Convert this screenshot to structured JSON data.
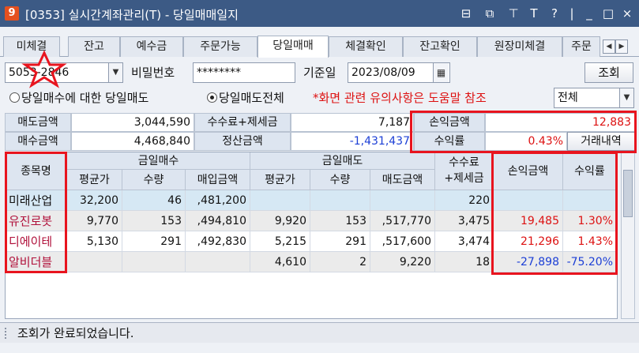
{
  "window": {
    "badge": "9",
    "title": "[0353] 실시간계좌관리(T) - 당일매매일지",
    "controls": [
      "⊟",
      "⧉",
      "⊤",
      "T",
      "?",
      "|",
      "_",
      "□",
      "×"
    ]
  },
  "tabs": [
    {
      "label": "미체결",
      "active": false
    },
    {
      "label": "잔고",
      "active": false
    },
    {
      "label": "예수금",
      "active": false
    },
    {
      "label": "주문가능",
      "active": false
    },
    {
      "label": "당일매매",
      "active": true
    },
    {
      "label": "체결확인",
      "active": false
    },
    {
      "label": "잔고확인",
      "active": false
    },
    {
      "label": "원장미체결",
      "active": false
    },
    {
      "label": "주문",
      "active": false
    }
  ],
  "tab_nav": {
    "prev": "◀",
    "next": "▶"
  },
  "account_row": {
    "account_value": "5053-2846",
    "password_label": "비밀번호",
    "password_value": "********",
    "base_date_label": "기준일",
    "base_date_value": "2023/08/09",
    "query_button": "조회"
  },
  "options_row": {
    "radio1_label": "당일매수에 대한 당일매도",
    "radio2_label": "당일매도전체",
    "selected": "radio2",
    "notice": "*화면 관련 유의사항은 도움말 참조",
    "filter_value": "전체"
  },
  "summary": {
    "sell_amount_label": "매도금액",
    "sell_amount": "3,044,590",
    "fee_tax_label": "수수료+제세금",
    "fee_tax": "7,187",
    "pnl_label": "손익금액",
    "pnl": "12,883",
    "buy_amount_label": "매수금액",
    "buy_amount": "4,468,840",
    "settle_label": "정산금액",
    "settle": "-1,431,437",
    "return_label": "수익률",
    "return": "0.43%",
    "history_button": "거래내역"
  },
  "grid": {
    "headers": {
      "name": "종목명",
      "buy_group": "금일매수",
      "sell_group": "금일매도",
      "fee": "수수료\n+제세금",
      "pnl": "손익금액",
      "ret": "수익률",
      "buy_avg": "평균가",
      "buy_qty": "수량",
      "buy_amt": "매입금액",
      "sell_avg": "평균가",
      "sell_qty": "수량",
      "sell_amt": "매도금액"
    },
    "rows": [
      {
        "name": "미래산업",
        "buy_avg": "32,200",
        "buy_qty": "46",
        "buy_amt": ",481,200",
        "sell_avg": "",
        "sell_qty": "",
        "sell_amt": "",
        "fee": "220",
        "pnl": "",
        "ret": ""
      },
      {
        "name": "유진로봇",
        "buy_avg": "9,770",
        "buy_qty": "153",
        "buy_amt": ",494,810",
        "sell_avg": "9,920",
        "sell_qty": "153",
        "sell_amt": ",517,770",
        "fee": "3,475",
        "pnl": "19,485",
        "ret": "1.30%"
      },
      {
        "name": "디에이테",
        "buy_avg": "5,130",
        "buy_qty": "291",
        "buy_amt": ",492,830",
        "sell_avg": "5,215",
        "sell_qty": "291",
        "sell_amt": ",517,600",
        "fee": "3,474",
        "pnl": "21,296",
        "ret": "1.43%"
      },
      {
        "name": "알비더블",
        "buy_avg": "",
        "buy_qty": "",
        "buy_amt": "",
        "sell_avg": "4,610",
        "sell_qty": "2",
        "sell_amt": "9,220",
        "fee": "18",
        "pnl": "-27,898",
        "ret": "-75.20%"
      }
    ]
  },
  "status": {
    "text": "조회가 완료되었습니다."
  },
  "colors": {
    "titlebar": "#3c5a85",
    "highlight_box": "#e8141e",
    "negative": "#1c3fd6",
    "positive": "#d11111"
  }
}
